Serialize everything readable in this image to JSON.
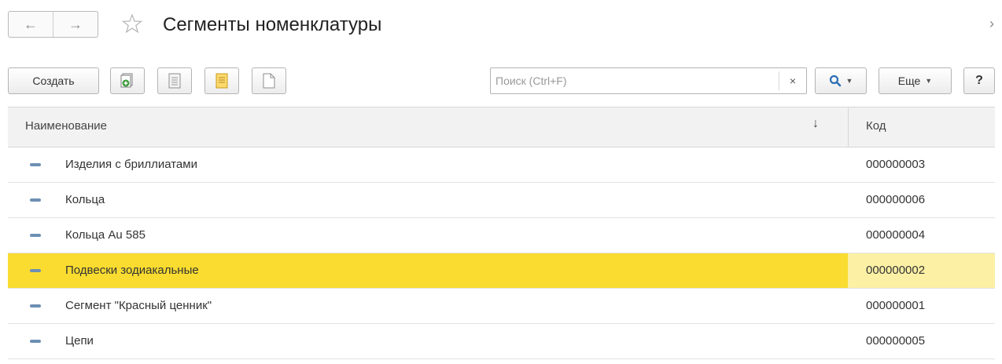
{
  "header": {
    "back_symbol": "←",
    "forward_symbol": "→",
    "title": "Сегменты номенклатуры",
    "more_symbol": "›"
  },
  "toolbar": {
    "create_label": "Создать",
    "search_placeholder": "Поиск (Ctrl+F)",
    "search_value": "",
    "clear_symbol": "×",
    "more_label": "Еще",
    "help_label": "?",
    "icons": [
      "copy-add-icon",
      "document-icon",
      "note-icon",
      "blank-page-icon",
      "search-icon"
    ]
  },
  "table": {
    "columns": [
      "Наименование",
      "Код"
    ],
    "sort_symbol": "↓",
    "rows": [
      {
        "name": "Изделия с бриллиатами",
        "code": "000000003",
        "selected": false
      },
      {
        "name": "Кольца",
        "code": "000000006",
        "selected": false
      },
      {
        "name": "Кольца Au 585",
        "code": "000000004",
        "selected": false
      },
      {
        "name": "Подвески зодиакальные",
        "code": "000000002",
        "selected": true
      },
      {
        "name": "Сегмент \"Красный ценник\"",
        "code": "000000001",
        "selected": false
      },
      {
        "name": "Цепи",
        "code": "000000005",
        "selected": false
      }
    ]
  },
  "colors": {
    "selected_row": "#f9dc2f",
    "selected_code_cell": "#fcf0a4",
    "row_icon": "#6d8fb3",
    "accent": "#2b6fb5"
  }
}
